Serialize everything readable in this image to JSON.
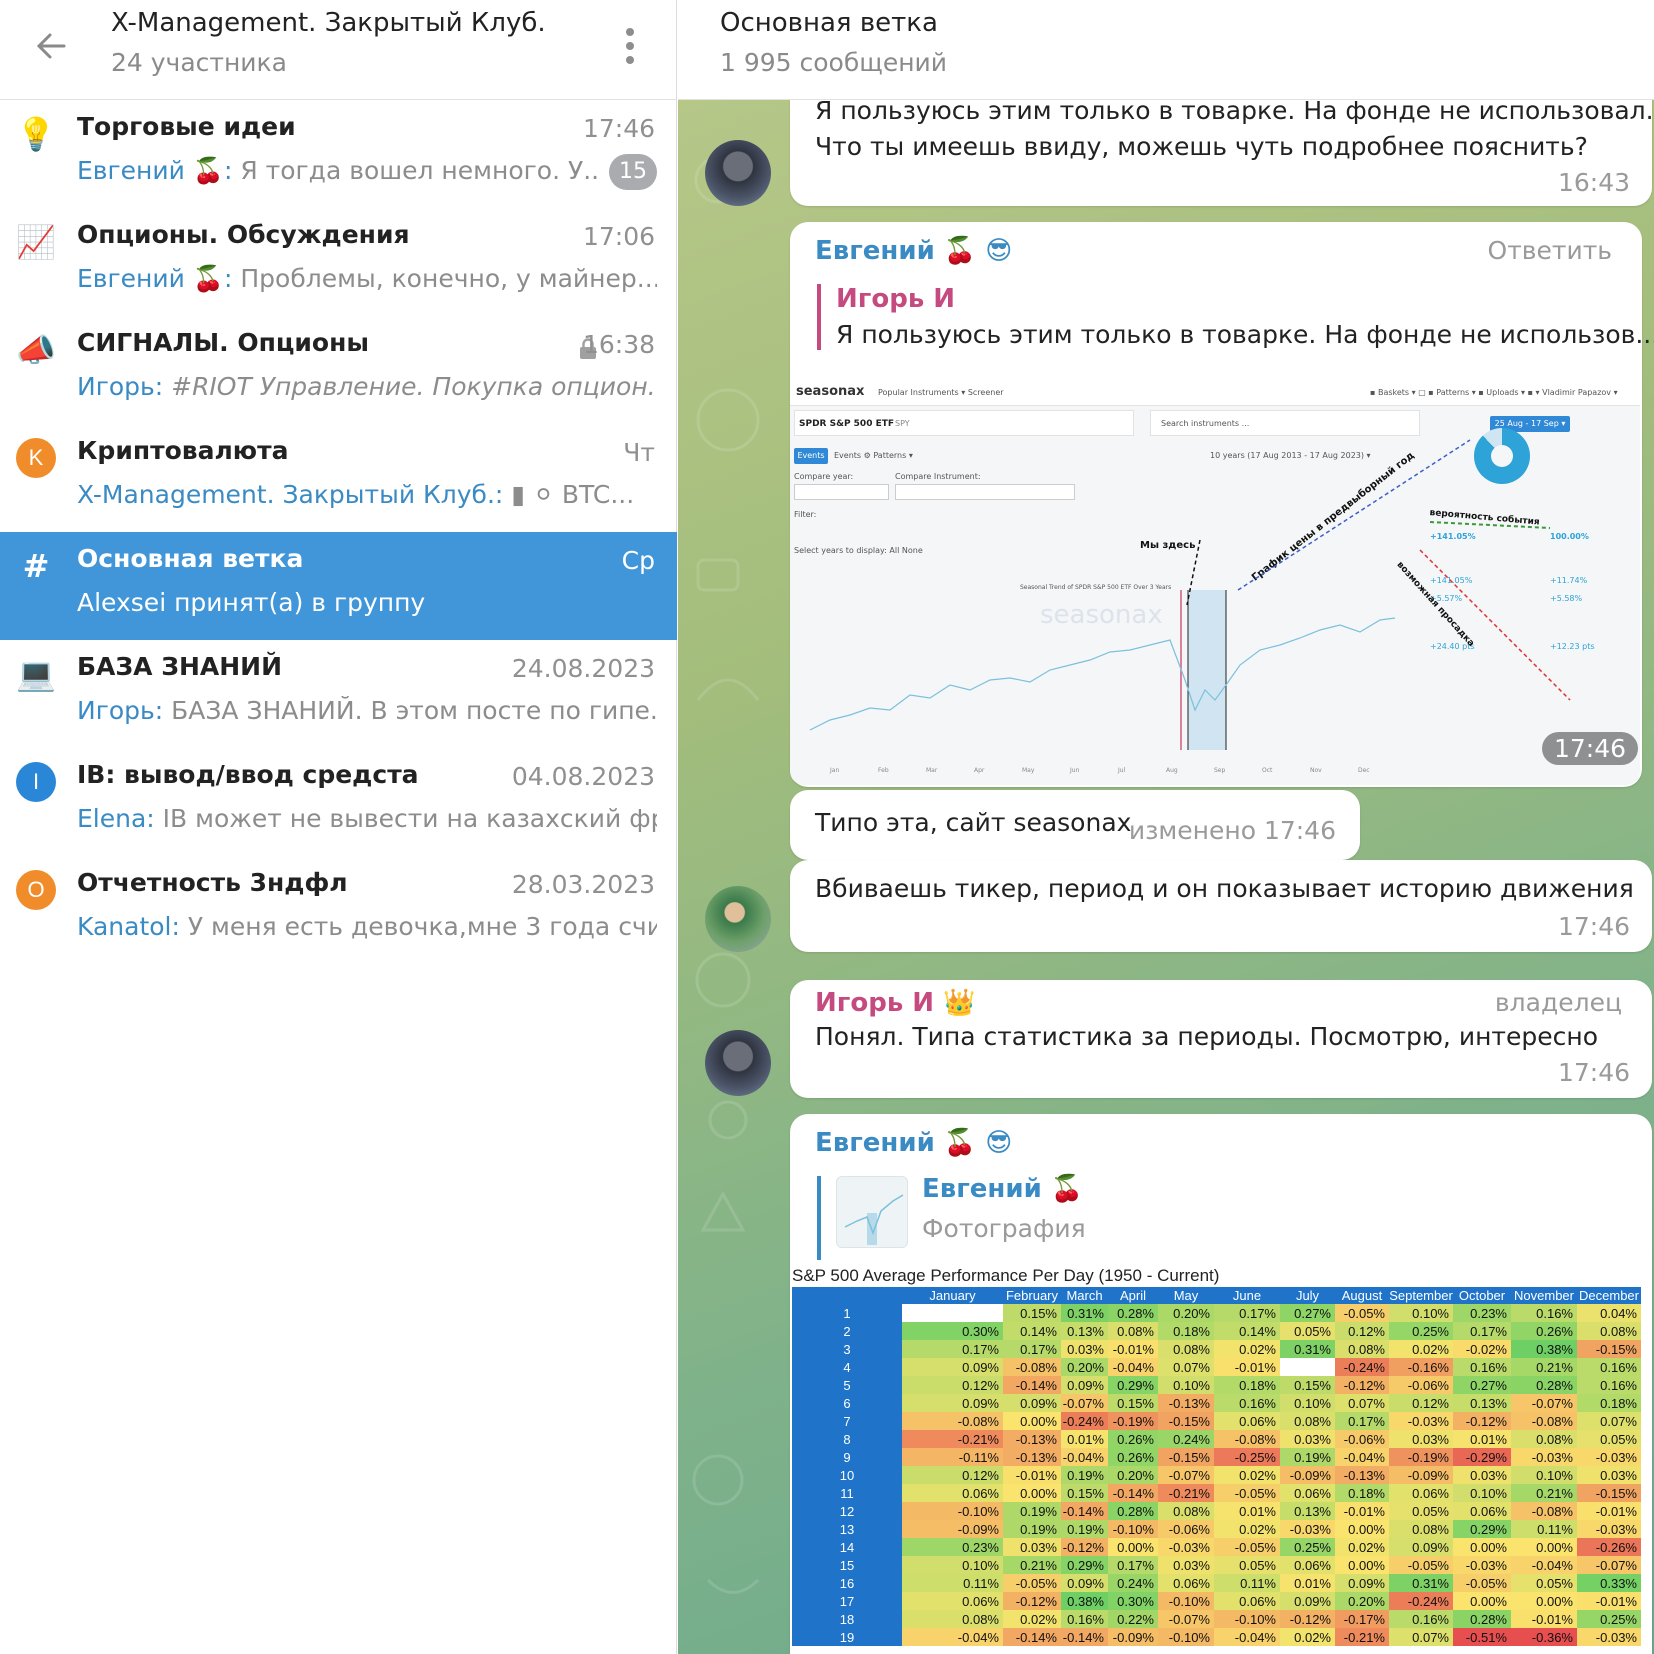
{
  "left": {
    "title": "X-Management. Закрытый Клуб.",
    "subtitle": "24 участника",
    "chats": [
      {
        "name": "Торговые идеи",
        "time": "17:46",
        "sender": "Евгений 🍒",
        "sep": ":",
        "text": " Я тогда вошел немного. У...",
        "badge": "15",
        "icon": "💡"
      },
      {
        "name": "Опционы. Обсуждения",
        "time": "17:06",
        "sender": "Евгений 🍒",
        "sep": ":",
        "text": " Проблемы, конечно, у майнер...",
        "icon": "📈"
      },
      {
        "name": "СИГНАЛЫ. Опционы",
        "time": "16:38",
        "sender": "Игорь",
        "sep": ":",
        "text": " #RIOT Управление.   Покупка опцион...",
        "icon": "📣"
      },
      {
        "name": "Криптовалюта",
        "time": "Чт",
        "sender": "X-Management. Закрытый Клуб.",
        "sep": ":",
        "text": " ▮ ⚪ BTC...",
        "icon": "K"
      },
      {
        "name": "Основная ветка",
        "time": "Ср",
        "sender": "",
        "sep": "",
        "text": "Alexsei принят(а) в группу",
        "icon": "#"
      },
      {
        "name": "БАЗА ЗНАНИЙ",
        "time": "24.08.2023",
        "sender": "Игорь",
        "sep": ":",
        "text": " БАЗА ЗНАНИЙ.   В этом посте по гипе...",
        "icon": "💻"
      },
      {
        "name": "IB: вывод/ввод средста",
        "time": "04.08.2023",
        "sender": "Elena",
        "sep": ":",
        "text": " IB может не вывести на казахский фр...",
        "icon": "I"
      },
      {
        "name": "Отчетность 3ндфл",
        "time": "28.03.2023",
        "sender": "Kanatol",
        "sep": ":",
        "text": " У меня есть девочка,мне 3 года счи...",
        "icon": "O"
      }
    ]
  },
  "right": {
    "title": "Основная ветка",
    "subtitle": "1 995 сообщений",
    "msg1": {
      "line1": "Я пользуюсь этим только в товарке. На фонде не использовал.",
      "line2": "Что ты имеешь ввиду, можешь чуть подробнее пояснить?",
      "time": "16:43"
    },
    "msg2": {
      "author": "Евгений 🍒 😎",
      "reply_action": "Ответить",
      "quote_author": "Игорь И",
      "quote_text": "Я пользуюсь этим только в товарке. На фонде не использов...",
      "time": "17:46"
    },
    "msg3": {
      "text": "Типо эта, сайт seasonax",
      "meta": "изменено 17:46"
    },
    "msg4": {
      "text": "Вбиваешь тикер, период и он показывает историю движения",
      "time": "17:46"
    },
    "msg5": {
      "author": "Игорь И 👑",
      "role": "владелец",
      "text": "Понял. Типа статистика за периоды. Посмотрю, интересно",
      "time": "17:46"
    },
    "msg6": {
      "author": "Евгений 🍒 😎",
      "quote_author": "Евгений 🍒",
      "quote_text": "Фотография"
    },
    "seasonax": {
      "logo": "seasonax",
      "nav": "Popular Instruments ▾    Screener",
      "instrument": "SPDR S&P 500 ETF",
      "ticker": "SPY",
      "search": "Search instruments ...",
      "period": "25 Aug - 17 Sep ▾",
      "tabs": "Events   ⚙ Patterns ▾",
      "range": "10 years (17 Aug 2013 - 17 Aug 2023) ▾",
      "chart_title": "Seasonal Trend of SPDR S&P 500 ETF Over 3 Years",
      "watermark": "seasonax",
      "anno1": "Мы здесь",
      "anno2": "График цены в предвыборный год",
      "anno3": "вероятность события",
      "anno4": "возможная просадка",
      "stat1": "+141.05%",
      "stat2": "100.00%",
      "stat3": "+141.05%",
      "stat4": "+11.74%",
      "stat5": "+5.57%",
      "stat6": "+5.58%",
      "stat7": "+24.40 pts",
      "stat8": "+12.23 pts",
      "compare_year": "Compare year:",
      "compare_instr": "Compare Instrument:",
      "filter": "Filter:",
      "years": "Select years to display:   All   None",
      "months": [
        "Jan",
        "Feb",
        "Mar",
        "Apr",
        "May",
        "Jun",
        "Jul",
        "Aug",
        "Sep",
        "Oct",
        "Nov",
        "Dec"
      ]
    },
    "heatmap": {
      "title": "S&P 500 Average Performance Per Day (1950 - Current)",
      "months": [
        "January",
        "February",
        "March",
        "April",
        "May",
        "June",
        "July",
        "August",
        "September",
        "October",
        "November",
        "December"
      ],
      "rows": [
        [
          "1",
          "",
          "0.15%",
          "0.31%",
          "0.28%",
          "0.20%",
          "0.17%",
          "0.27%",
          "-0.05%",
          "0.10%",
          "0.23%",
          "0.16%",
          "0.04%"
        ],
        [
          "2",
          "0.30%",
          "0.14%",
          "0.13%",
          "0.08%",
          "0.18%",
          "0.14%",
          "0.05%",
          "0.12%",
          "0.25%",
          "0.17%",
          "0.26%",
          "0.08%"
        ],
        [
          "3",
          "0.17%",
          "0.17%",
          "0.03%",
          "-0.01%",
          "0.08%",
          "0.02%",
          "0.31%",
          "0.08%",
          "0.02%",
          "-0.02%",
          "0.38%",
          "-0.15%"
        ],
        [
          "4",
          "0.09%",
          "-0.08%",
          "0.20%",
          "-0.04%",
          "0.07%",
          "-0.01%",
          "",
          "-0.24%",
          "-0.16%",
          "0.16%",
          "0.21%",
          "0.16%"
        ],
        [
          "5",
          "0.12%",
          "-0.14%",
          "0.09%",
          "0.29%",
          "0.10%",
          "0.18%",
          "0.15%",
          "-0.12%",
          "-0.06%",
          "0.27%",
          "0.28%",
          "0.16%"
        ],
        [
          "6",
          "0.09%",
          "0.09%",
          "-0.07%",
          "0.15%",
          "-0.13%",
          "0.16%",
          "0.10%",
          "0.07%",
          "0.12%",
          "0.13%",
          "-0.07%",
          "0.18%"
        ],
        [
          "7",
          "-0.08%",
          "0.00%",
          "-0.24%",
          "-0.19%",
          "-0.15%",
          "0.06%",
          "0.08%",
          "0.17%",
          "-0.03%",
          "-0.12%",
          "-0.08%",
          "0.07%"
        ],
        [
          "8",
          "-0.21%",
          "-0.13%",
          "0.01%",
          "0.26%",
          "0.24%",
          "-0.08%",
          "0.03%",
          "-0.06%",
          "0.03%",
          "0.01%",
          "0.08%",
          "0.05%"
        ],
        [
          "9",
          "-0.11%",
          "-0.13%",
          "-0.04%",
          "0.26%",
          "-0.15%",
          "-0.25%",
          "0.19%",
          "-0.04%",
          "-0.19%",
          "-0.29%",
          "-0.03%",
          "-0.03%"
        ],
        [
          "10",
          "0.12%",
          "-0.01%",
          "0.19%",
          "0.20%",
          "-0.07%",
          "0.02%",
          "-0.09%",
          "-0.13%",
          "-0.09%",
          "0.03%",
          "0.10%",
          "0.03%"
        ],
        [
          "11",
          "0.06%",
          "0.00%",
          "0.15%",
          "-0.14%",
          "-0.21%",
          "-0.05%",
          "0.06%",
          "0.18%",
          "0.06%",
          "0.10%",
          "0.21%",
          "-0.15%"
        ],
        [
          "12",
          "-0.10%",
          "0.19%",
          "-0.14%",
          "0.28%",
          "0.08%",
          "0.01%",
          "0.13%",
          "-0.01%",
          "0.05%",
          "0.06%",
          "-0.08%",
          "-0.01%"
        ],
        [
          "13",
          "-0.09%",
          "0.19%",
          "0.19%",
          "-0.10%",
          "-0.06%",
          "0.02%",
          "-0.03%",
          "0.00%",
          "0.08%",
          "0.29%",
          "0.11%",
          "-0.03%"
        ],
        [
          "14",
          "0.23%",
          "0.03%",
          "-0.12%",
          "0.00%",
          "-0.03%",
          "-0.05%",
          "0.25%",
          "0.02%",
          "0.09%",
          "0.00%",
          "0.00%",
          "-0.26%"
        ],
        [
          "15",
          "0.10%",
          "0.21%",
          "0.29%",
          "0.17%",
          "0.03%",
          "0.05%",
          "0.06%",
          "0.00%",
          "-0.05%",
          "-0.03%",
          "-0.04%",
          "-0.07%"
        ],
        [
          "16",
          "0.11%",
          "-0.05%",
          "0.09%",
          "0.24%",
          "0.06%",
          "0.11%",
          "0.01%",
          "0.09%",
          "0.31%",
          "-0.05%",
          "0.05%",
          "0.33%"
        ],
        [
          "17",
          "0.06%",
          "-0.12%",
          "0.38%",
          "0.30%",
          "-0.10%",
          "0.06%",
          "0.09%",
          "0.20%",
          "-0.24%",
          "0.00%",
          "0.00%",
          "-0.01%"
        ],
        [
          "18",
          "0.08%",
          "0.02%",
          "0.16%",
          "0.22%",
          "-0.07%",
          "-0.10%",
          "-0.12%",
          "-0.17%",
          "0.16%",
          "0.28%",
          "-0.01%",
          "0.25%"
        ],
        [
          "19",
          "-0.04%",
          "-0.14%",
          "-0.14%",
          "-0.09%",
          "-0.10%",
          "-0.04%",
          "0.02%",
          "-0.21%",
          "0.07%",
          "-0.51%",
          "-0.36%",
          "-0.03%"
        ]
      ]
    }
  },
  "colors": {
    "accent": "#4096d8",
    "sender": "#3a8ac4",
    "evgeny": "#3a8ac4",
    "igor": "#c44a7f"
  }
}
